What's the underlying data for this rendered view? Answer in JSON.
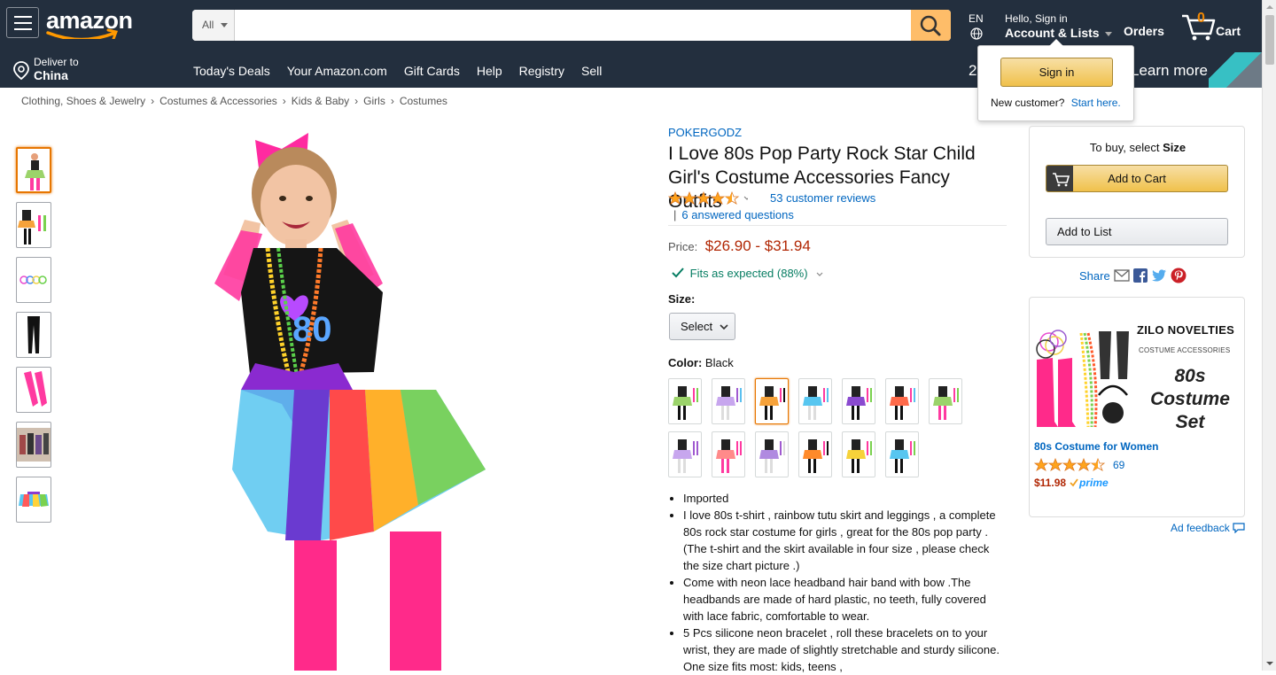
{
  "header": {
    "logo": "amazon",
    "search": {
      "category": "All",
      "placeholder": "",
      "value": ""
    },
    "lang": "EN",
    "account_hello": "Hello, Sign in",
    "account_lists": "Account & Lists",
    "orders": "Orders",
    "cart_count": "0",
    "cart_label": "Cart",
    "deliver_line1": "Deliver to",
    "deliver_line2": "China",
    "nav_links": [
      "Today's Deals",
      "Your Amazon.com",
      "Gift Cards",
      "Help",
      "Registry",
      "Sell"
    ],
    "promo_left": "2",
    "promo_right": "Learn more"
  },
  "flyout": {
    "signin": "Sign in",
    "new_customer": "New customer?",
    "start_here": "Start here."
  },
  "breadcrumb": [
    "Clothing, Shoes & Jewelry",
    "Costumes & Accessories",
    "Kids & Baby",
    "Girls",
    "Costumes"
  ],
  "product": {
    "brand": "POKERGODZ",
    "title": "I Love 80s Pop Party Rock Star Child Girl's Costume Accessories Fancy Outfits",
    "rating": 4.5,
    "reviews": "53 customer reviews",
    "qa": "6 answered questions",
    "price_label": "Price:",
    "price": "$26.90 - $31.94",
    "fit": "Fits as expected (88%)",
    "size_label": "Size:",
    "size_value": "Select",
    "color_label": "Color:",
    "color_value": "Black",
    "bullets": [
      "Imported",
      "I love 80s t-shirt , rainbow tutu skirt and leggings , a complete 80s rock star costume for girls , great for the 80s pop party . (The t-shirt and the skirt available in four size , please check the size chart picture .)",
      "Come with neon lace headband hair band with bow .The headbands are made of hard plastic, no teeth, fully covered with lace fabric, comfortable to wear.",
      "5 Pcs silicone neon bracelet , roll these bracelets on to your wrist, they are made of slightly stretchable and sturdy silicone. One size fits most: kids, teens ,"
    ]
  },
  "buybox": {
    "to_buy": "To buy, select",
    "to_buy_bold": "Size",
    "add_to_cart": "Add to Cart",
    "add_to_list": "Add to List",
    "share": "Share"
  },
  "ad": {
    "brand": "ZILO NOVELTIES",
    "sub": "COSTUME ACCESSORIES",
    "big": "80s Costume Set",
    "link": "80s Costume for Women",
    "rating": 4.5,
    "count": "69",
    "price": "$11.98",
    "prime": "prime",
    "feedback": "Ad feedback"
  },
  "colors": {
    "nav": "#232f3e",
    "accent": "#febd69",
    "link": "#0066c0",
    "price": "#b12704",
    "star": "#ffa41c"
  }
}
